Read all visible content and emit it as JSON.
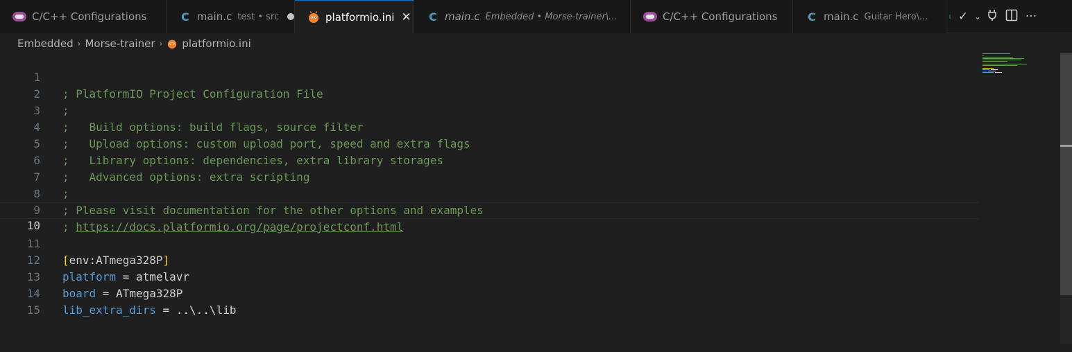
{
  "tabs": [
    {
      "label": "C/C++ Configurations",
      "description": "",
      "icon": "cpp-config-icon",
      "italic": false,
      "active": false,
      "dirty": false
    },
    {
      "label": "main.c",
      "description": "test • src",
      "icon": "c-file-icon",
      "italic": false,
      "active": false,
      "dirty": true
    },
    {
      "label": "platformio.ini",
      "description": "",
      "icon": "platformio-icon",
      "italic": false,
      "active": true,
      "dirty": false
    },
    {
      "label": "main.c",
      "description": "Embedded • Morse-trainer\\...",
      "icon": "c-file-icon",
      "italic": true,
      "active": false,
      "dirty": false
    },
    {
      "label": "C/C++ Configurations",
      "description": "",
      "icon": "cpp-config-icon",
      "italic": false,
      "active": false,
      "dirty": false
    },
    {
      "label": "main.c",
      "description": "Guitar Hero\\...",
      "icon": "c-file-icon",
      "italic": false,
      "active": false,
      "dirty": false
    }
  ],
  "icons": {
    "check": "✓",
    "chevron": "⌄",
    "plug": "⏻",
    "split": "◫",
    "more": "···",
    "close": "✕",
    "c": "C",
    "crumb_sep": "›"
  },
  "breadcrumbs": [
    "Embedded",
    "Morse-trainer",
    "platformio.ini"
  ],
  "editor": {
    "current_line": 10,
    "lines": [
      {
        "n": "1",
        "text": "; PlatformIO Project Configuration File"
      },
      {
        "n": "2",
        "text": ";"
      },
      {
        "n": "3",
        "text": ";   Build options: build flags, source filter"
      },
      {
        "n": "4",
        "text": ";   Upload options: custom upload port, speed and extra flags"
      },
      {
        "n": "5",
        "text": ";   Library options: dependencies, extra library storages"
      },
      {
        "n": "6",
        "text": ";   Advanced options: extra scripting"
      },
      {
        "n": "7",
        "text": ";"
      },
      {
        "n": "8",
        "text": "; Please visit documentation for the other options and examples"
      },
      {
        "n": "9",
        "prefix": "; ",
        "url": "https://docs.platformio.org/page/projectconf.html"
      },
      {
        "n": "10",
        "text": ""
      },
      {
        "n": "11",
        "open": "[",
        "section": "env:ATmega328P",
        "close": "]"
      },
      {
        "n": "12",
        "key": "platform",
        "eq": " = ",
        "value": "atmelavr"
      },
      {
        "n": "13",
        "key": "board",
        "eq": " = ",
        "value": "ATmega328P"
      },
      {
        "n": "14",
        "key": "lib_extra_dirs",
        "eq": " = ",
        "value": "..\\..\\lib"
      },
      {
        "n": "15",
        "text": ""
      }
    ]
  },
  "colors": {
    "comment": "#6a9955",
    "key": "#569cd6",
    "bracket": "#ffd700",
    "accent": "#0078d4"
  }
}
